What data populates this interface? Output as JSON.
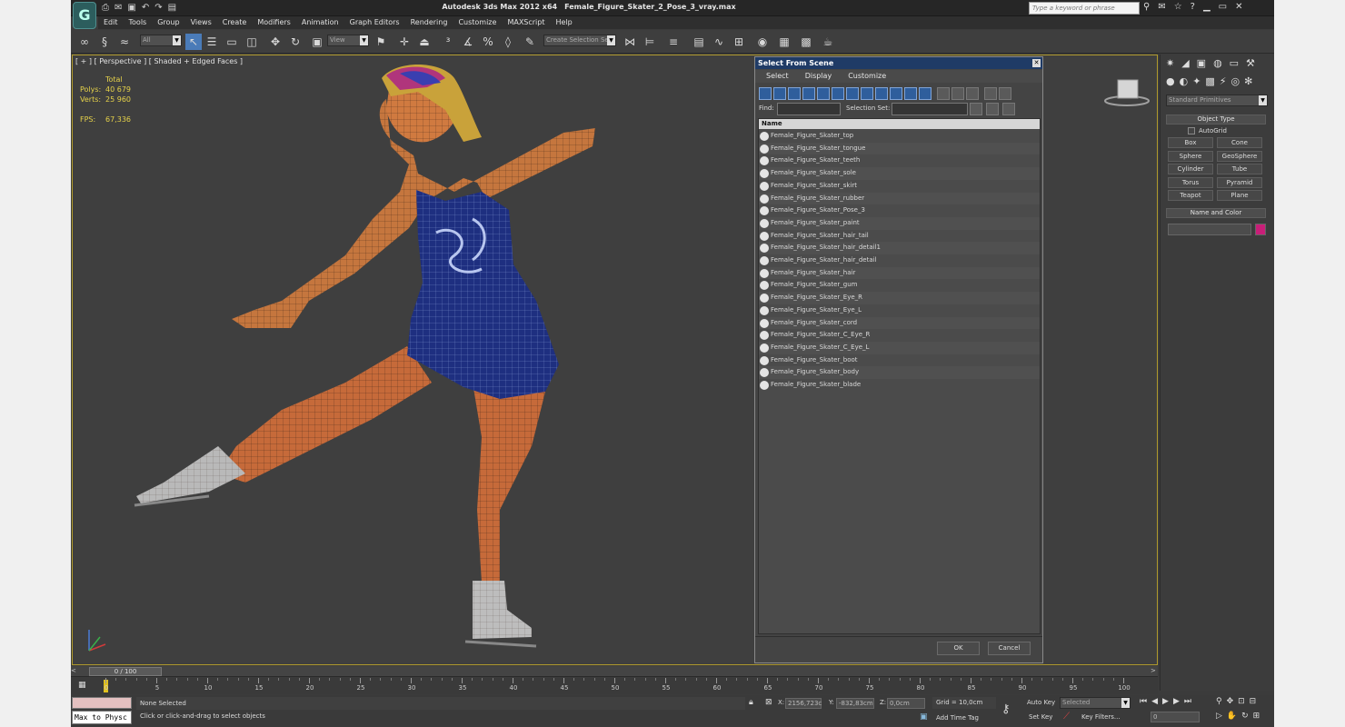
{
  "app": {
    "title": "Autodesk 3ds Max  2012 x64",
    "file": "Female_Figure_Skater_2_Pose_3_vray.max",
    "logo": "G",
    "search_placeholder": "Type a keyword or phrase"
  },
  "menu": [
    "Edit",
    "Tools",
    "Group",
    "Views",
    "Create",
    "Modifiers",
    "Animation",
    "Graph Editors",
    "Rendering",
    "Customize",
    "MAXScript",
    "Help"
  ],
  "toolbar": {
    "filter": "All",
    "refcoord": "View",
    "selset": "Create Selection Se"
  },
  "viewport": {
    "label": "[ + ] [ Perspective ] [ Shaded + Edged Faces ]",
    "stats": {
      "header": "Total",
      "polys_label": "Polys:",
      "polys": "40 679",
      "verts_label": "Verts:",
      "verts": "25 960",
      "fps_label": "FPS:",
      "fps": "67,336"
    }
  },
  "dialog": {
    "title": "Select From Scene",
    "menu": [
      "Select",
      "Display",
      "Customize"
    ],
    "find_label": "Find:",
    "selset_label": "Selection Set:",
    "column": "Name",
    "items": [
      "Female_Figure_Skater_top",
      "Female_Figure_Skater_tongue",
      "Female_Figure_Skater_teeth",
      "Female_Figure_Skater_sole",
      "Female_Figure_Skater_skirt",
      "Female_Figure_Skater_rubber",
      "Female_Figure_Skater_Pose_3",
      "Female_Figure_Skater_paint",
      "Female_Figure_Skater_hair_tail",
      "Female_Figure_Skater_hair_detail1",
      "Female_Figure_Skater_hair_detail",
      "Female_Figure_Skater_hair",
      "Female_Figure_Skater_gum",
      "Female_Figure_Skater_Eye_R",
      "Female_Figure_Skater_Eye_L",
      "Female_Figure_Skater_cord",
      "Female_Figure_Skater_C_Eye_R",
      "Female_Figure_Skater_C_Eye_L",
      "Female_Figure_Skater_boot",
      "Female_Figure_Skater_body",
      "Female_Figure_Skater_blade"
    ],
    "ok": "OK",
    "cancel": "Cancel"
  },
  "command_panel": {
    "dropdown": "Standard Primitives",
    "object_type": "Object Type",
    "autogrid": "AutoGrid",
    "buttons": [
      "Box",
      "Cone",
      "Sphere",
      "GeoSphere",
      "Cylinder",
      "Tube",
      "Torus",
      "Pyramid",
      "Teapot",
      "Plane"
    ],
    "name_color": "Name and Color",
    "swatch_color": "#c81e78"
  },
  "timeline": {
    "frame": "0 / 100",
    "ticks": [
      "0",
      "5",
      "10",
      "15",
      "20",
      "25",
      "30",
      "35",
      "40",
      "45",
      "50",
      "55",
      "60",
      "65",
      "70",
      "75",
      "80",
      "85",
      "90",
      "95",
      "100"
    ]
  },
  "status": {
    "script": "Max to Physc",
    "selection": "None Selected",
    "prompt": "Click or click-and-drag to select objects",
    "x_label": "X:",
    "x": "2156,723c",
    "y_label": "Y:",
    "y": "-832,83cm",
    "z_label": "Z:",
    "z": "0,0cm",
    "grid": "Grid = 10,0cm",
    "add_time_tag": "Add Time Tag",
    "auto_key": "Auto Key",
    "set_key": "Set Key",
    "key_mode": "Selected",
    "key_filters": "Key Filters...",
    "frame_field": "0",
    "viewcube": "RIGHT"
  }
}
